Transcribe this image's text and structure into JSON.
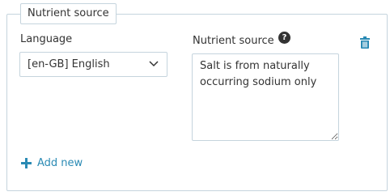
{
  "section": {
    "legend": "Nutrient source"
  },
  "language": {
    "label": "Language",
    "selected": "[en-GB] English"
  },
  "nutrient_source": {
    "label": "Nutrient source",
    "help_icon": "?",
    "value": "Salt is from naturally occurring sodium only"
  },
  "actions": {
    "add_new_label": "Add new"
  },
  "icons": {
    "select_arrow": "chevron-down-icon",
    "help": "help-icon",
    "delete": "trash-icon",
    "add": "plus-icon"
  },
  "colors": {
    "border": "#c5d4dd",
    "accent": "#2a8ab4",
    "text": "#333333"
  }
}
